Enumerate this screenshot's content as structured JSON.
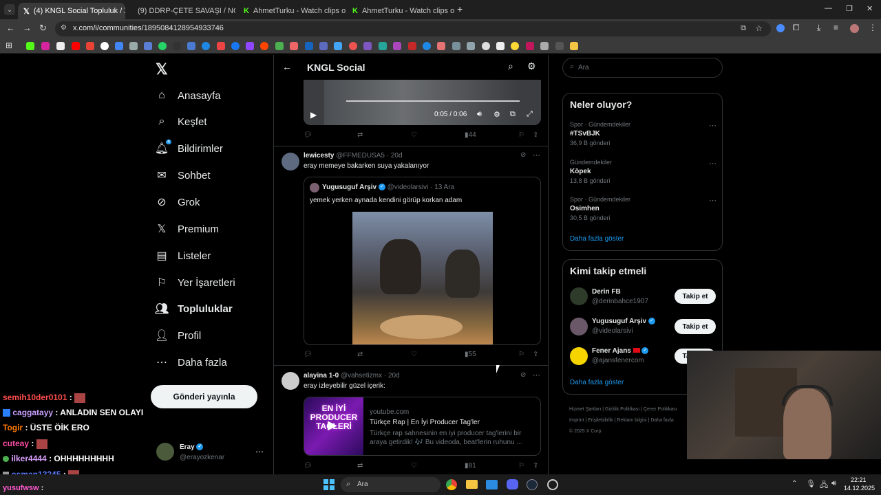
{
  "browser": {
    "tabs": [
      {
        "label": "(4) KNGL Social Topluluk / X",
        "active": true
      },
      {
        "label": "(9) DDRP-ÇETE SAVAŞI / NOBO",
        "active": false
      },
      {
        "label": "AhmetTurku - Watch clips on K",
        "active": false
      },
      {
        "label": "AhmetTurku - Watch clips on K",
        "active": false
      }
    ],
    "url": "x.com/i/communities/1895084128954933746"
  },
  "nav": {
    "items": [
      {
        "label": "Anasayfa",
        "icon": "home-icon"
      },
      {
        "label": "Keşfet",
        "icon": "search-icon"
      },
      {
        "label": "Bildirimler",
        "icon": "bell-icon",
        "badge": "4"
      },
      {
        "label": "Sohbet",
        "icon": "mail-icon"
      },
      {
        "label": "Grok",
        "icon": "grok-icon"
      },
      {
        "label": "Premium",
        "icon": "x-logo-icon"
      },
      {
        "label": "Listeler",
        "icon": "list-icon"
      },
      {
        "label": "Yer İşaretleri",
        "icon": "bookmark-icon"
      },
      {
        "label": "Topluluklar",
        "icon": "communities-icon"
      },
      {
        "label": "Profil",
        "icon": "profile-icon"
      },
      {
        "label": "Daha fazla",
        "icon": "more-icon"
      }
    ],
    "post_button": "Gönderi yayınla",
    "account": {
      "name": "Eray",
      "handle": "@erayozkenar"
    }
  },
  "header": {
    "title": "KNGL Social"
  },
  "video": {
    "time": "0:05 / 0:06",
    "views": "44"
  },
  "post1": {
    "name": "lewicesty",
    "handle": "@FFMEDUSA5",
    "time": "· 20d",
    "text": "eray memeye bakarken suya yakalanıyor",
    "quote": {
      "name": "Yugusuguf Arşiv",
      "handle": "@videolarsivi",
      "time": "· 13 Ara",
      "text": "yemek yerken aynada kendini görüp korkan adam"
    },
    "views": "55"
  },
  "post2": {
    "name": "alayina 1-0",
    "handle": "@vahsetizmx",
    "time": "· 20d",
    "text": "eray izleyebilir güzel içerik:",
    "card": {
      "domain": "youtube.com",
      "title": "Türkçe Rap | En İyi Producer Tag'ler",
      "desc": "Türkçe rap sahnesinin en iyi producer tag'lerini bir araya getirdik! 🎶 Bu videoda, beat'lerin ruhunu ...",
      "thumb_text": "EN İYİ PRODUCER TAGLERİ"
    },
    "views": "81"
  },
  "search": {
    "placeholder": "Ara"
  },
  "trends": {
    "title": "Neler oluyor?",
    "items": [
      {
        "category": "Spor · Gündemdekiler",
        "name": "#TSvBJK",
        "count": "36,9 B gönderi"
      },
      {
        "category": "Gündemdekiler",
        "name": "Köpek",
        "count": "13,8 B gönderi"
      },
      {
        "category": "Spor · Gündemdekiler",
        "name": "Osimhen",
        "count": "30,5 B gönderi"
      }
    ],
    "more": "Daha fazla göster"
  },
  "who_to_follow": {
    "title": "Kimi takip etmeli",
    "items": [
      {
        "name": "Derin FB",
        "handle": "@derinbahce1907",
        "button": "Takip et"
      },
      {
        "name": "Yugusuguf Arşiv",
        "handle": "@videolarsivi",
        "button": "Takip et"
      },
      {
        "name": "Fener Ajans",
        "handle": "@ajansfenercom",
        "button": "Takip et"
      }
    ],
    "more": "Daha fazla göster"
  },
  "footer": {
    "links": [
      "Hizmet Şartları",
      "Gizlilik Politikası",
      "Çerez Politikası",
      "Imprint",
      "Erişilebilirlik",
      "Reklam bilgisi",
      "Daha fazla"
    ],
    "copyright": "© 2025 X Corp."
  },
  "chat": [
    {
      "user": "semih10der0101",
      "msg": ":",
      "color": "#ff4d4d"
    },
    {
      "user": "caggatayy",
      "msg": ": ANLADIN SEN OLAYI",
      "color": "#c9a0ff"
    },
    {
      "user": "Togir",
      "msg": ": ÜSTE ÖİK ERO",
      "color": "#ff7a00"
    },
    {
      "user": "cuteay",
      "msg": ":",
      "color": "#ff4da6"
    },
    {
      "user": "ilker4444",
      "msg": ": OHHHHHHHHH",
      "color": "#d9a0ff"
    },
    {
      "user": "osman13245",
      "msg": ":",
      "color": "#5a7bff"
    },
    {
      "user": "yusufwsw",
      "msg": ":",
      "color": "#ff5ad1"
    }
  ],
  "taskbar": {
    "search": "Ara",
    "time": "22:21",
    "date": "14.12.2025"
  }
}
